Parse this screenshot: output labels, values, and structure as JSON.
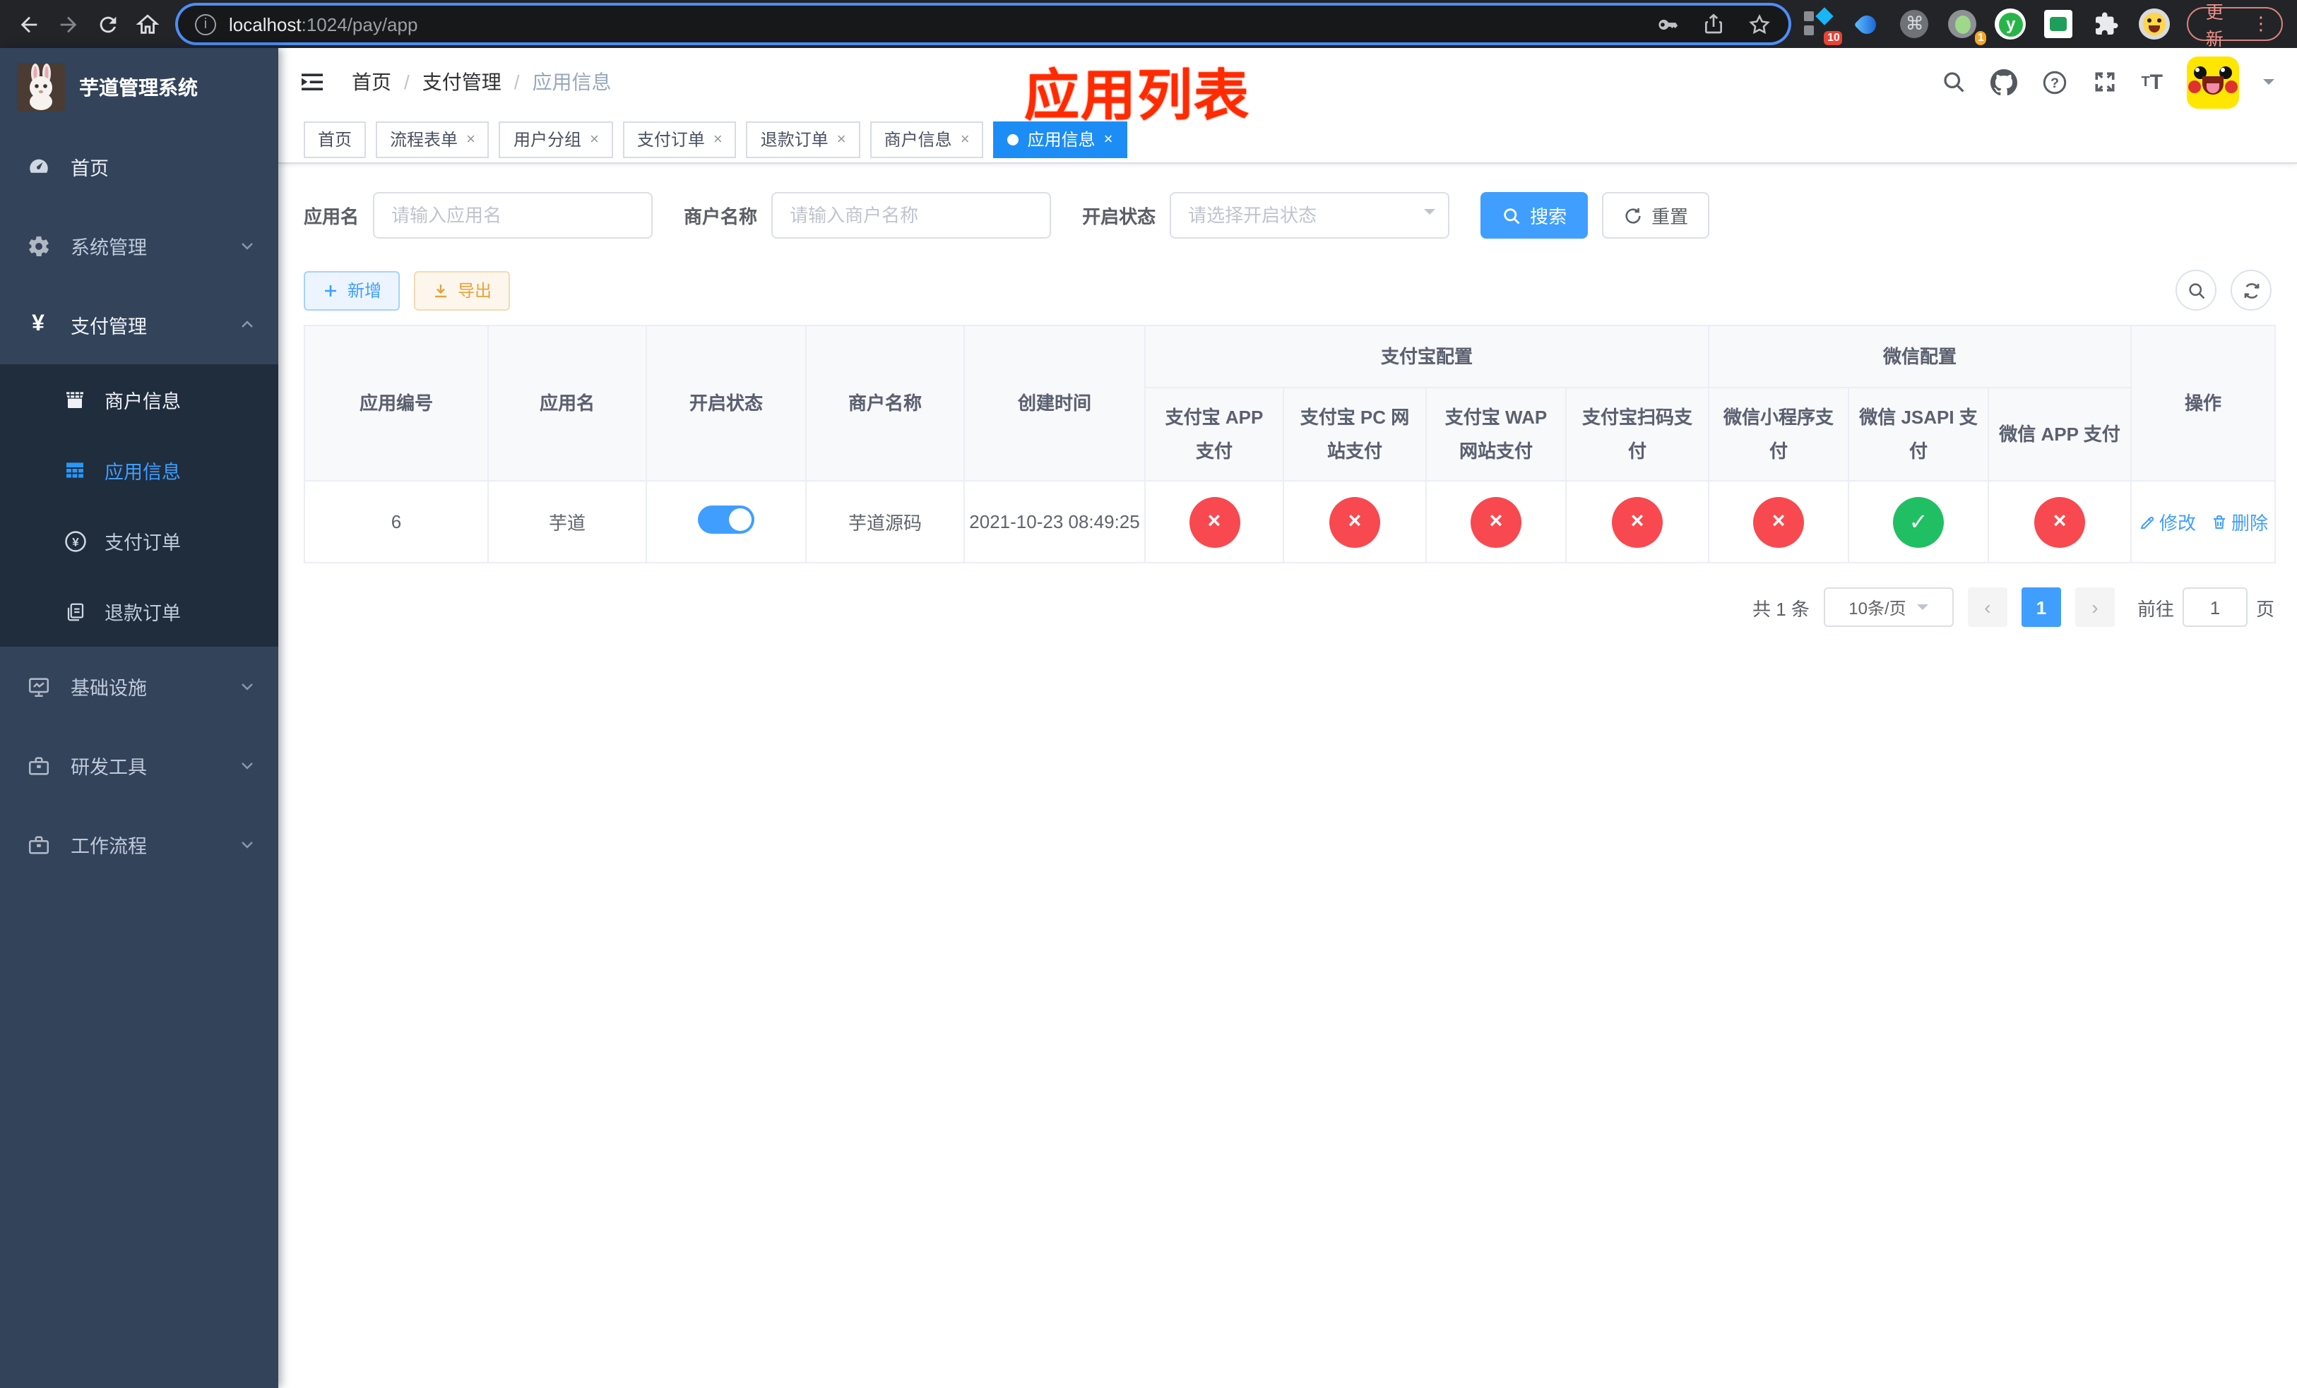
{
  "browser": {
    "url_host": "localhost",
    "url_path": ":1024/pay/app",
    "ext_badge_blue": "10",
    "ext_badge_orange": "1",
    "ext_y_letter": "y",
    "update_label": "更新"
  },
  "sidebar": {
    "title": "芋道管理系统",
    "items": [
      {
        "label": "首页"
      },
      {
        "label": "系统管理"
      },
      {
        "label": "支付管理"
      },
      {
        "label": "商户信息"
      },
      {
        "label": "应用信息"
      },
      {
        "label": "支付订单"
      },
      {
        "label": "退款订单"
      },
      {
        "label": "基础设施"
      },
      {
        "label": "研发工具"
      },
      {
        "label": "工作流程"
      }
    ]
  },
  "breadcrumb": {
    "home": "首页",
    "section": "支付管理",
    "current": "应用信息"
  },
  "annotation": {
    "text": "应用列表"
  },
  "tabs": [
    {
      "label": "首页"
    },
    {
      "label": "流程表单"
    },
    {
      "label": "用户分组"
    },
    {
      "label": "支付订单"
    },
    {
      "label": "退款订单"
    },
    {
      "label": "商户信息"
    },
    {
      "label": "应用信息"
    }
  ],
  "filters": {
    "app_name_label": "应用名",
    "app_name_placeholder": "请输入应用名",
    "merchant_label": "商户名称",
    "merchant_placeholder": "请输入商户名称",
    "status_label": "开启状态",
    "status_placeholder": "请选择开启状态",
    "search_label": "搜索",
    "reset_label": "重置"
  },
  "toolbar": {
    "add_label": "新增",
    "export_label": "导出"
  },
  "table": {
    "col_app_id": "应用编号",
    "col_app_name": "应用名",
    "col_enabled": "开启状态",
    "col_merchant": "商户名称",
    "col_created": "创建时间",
    "group_alipay": "支付宝配置",
    "group_wechat": "微信配置",
    "col_alipay_app": "支付宝 APP 支付",
    "col_alipay_pc": "支付宝 PC 网站支付",
    "col_alipay_wap": "支付宝 WAP 网站支付",
    "col_alipay_qr": "支付宝扫码支付",
    "col_wx_mini": "微信小程序支付",
    "col_wx_jsapi": "微信 JSAPI 支付",
    "col_wx_app": "微信 APP 支付",
    "col_op": "操作",
    "row": {
      "app_id": "6",
      "app_name": "芋道",
      "enabled": true,
      "merchant": "芋道源码",
      "created": "2021-10-23 08:49:25",
      "statuses": [
        false,
        false,
        false,
        false,
        false,
        true,
        false
      ],
      "action_edit": "修改",
      "action_delete": "删除"
    }
  },
  "pagination": {
    "total": "共 1 条",
    "page_size": "10条/页",
    "current_page": "1",
    "goto_label": "前往",
    "goto_value": "1",
    "unit_label": "页"
  }
}
